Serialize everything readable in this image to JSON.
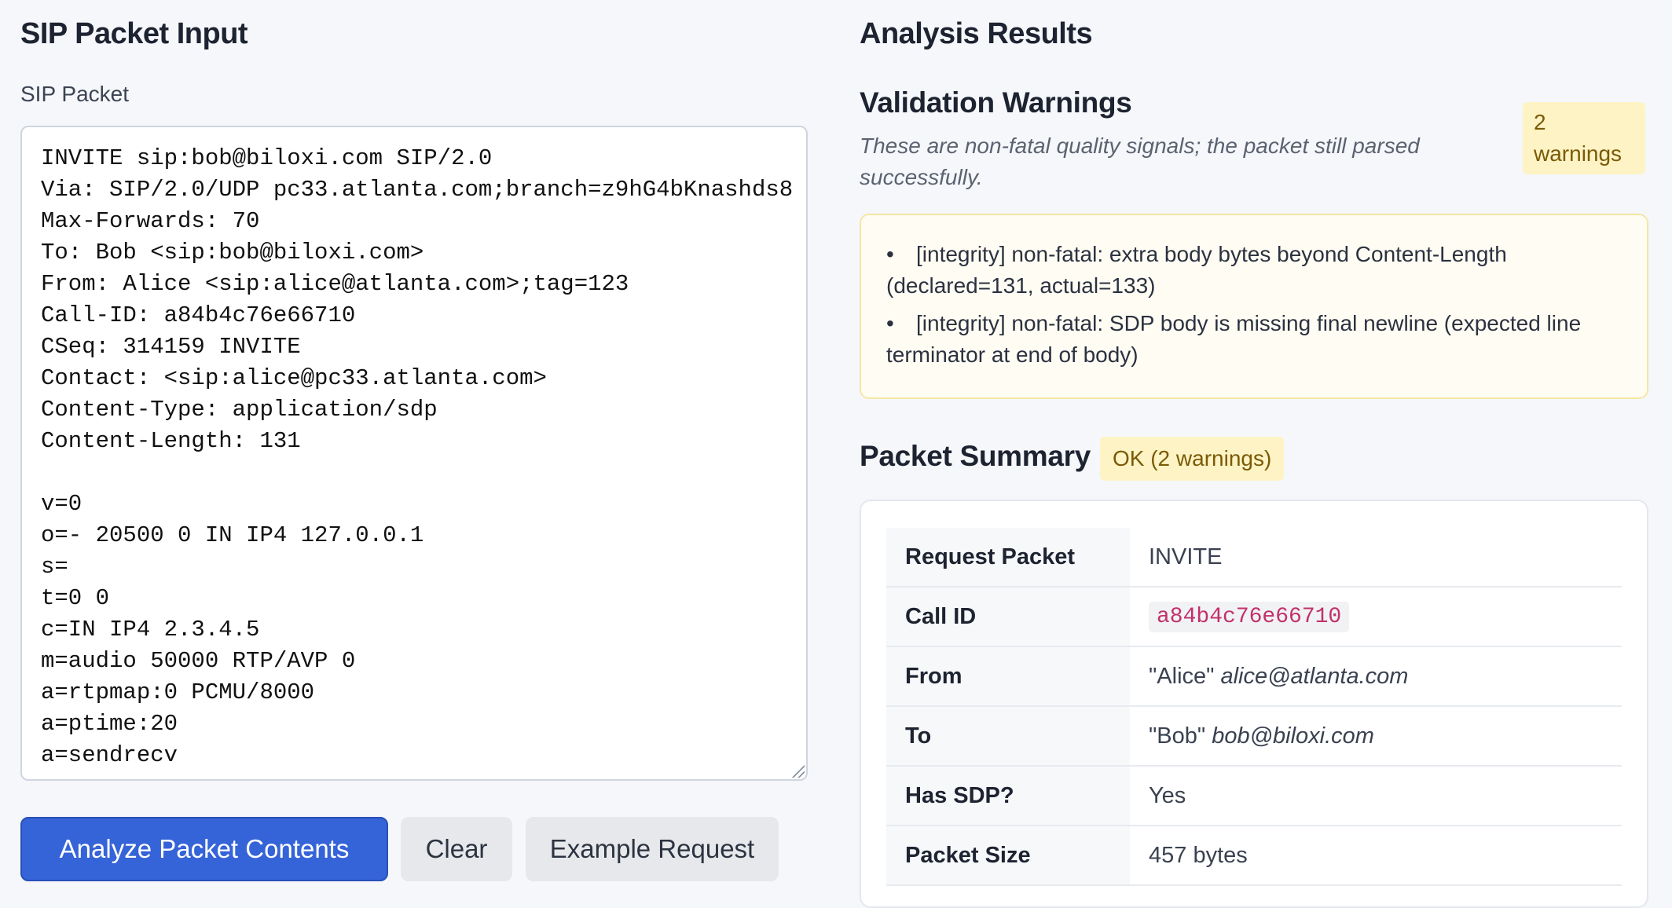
{
  "input": {
    "title": "SIP Packet Input",
    "field_label": "SIP Packet",
    "packet_lines": [
      "INVITE sip:bob@biloxi.com SIP/2.0",
      "Via: SIP/2.0/UDP pc33.atlanta.com;branch=z9hG4bKnashds8",
      "Max-Forwards: 70",
      "To: Bob <sip:bob@biloxi.com>",
      "From: Alice <sip:alice@atlanta.com>;tag=123",
      "Call-ID: a84b4c76e66710",
      "CSeq: 314159 INVITE",
      "Contact: <sip:alice@pc33.atlanta.com>",
      "Content-Type: application/sdp",
      "Content-Length: 131",
      "",
      "v=0",
      "o=- 20500 0 IN IP4 127.0.0.1",
      "s=",
      "t=0 0",
      "c=IN IP4 2.3.4.5",
      "m=audio 50000 RTP/AVP 0",
      "a=rtpmap:0 PCMU/8000",
      "a=ptime:20",
      "a=sendrecv"
    ],
    "buttons": {
      "analyze": "Analyze Packet Contents",
      "clear": "Clear",
      "example": "Example Request"
    }
  },
  "results": {
    "title": "Analysis Results",
    "warnings": {
      "title": "Validation Warnings",
      "description": "These are non-fatal quality signals; the packet still parsed successfully.",
      "count_label": "2 warnings",
      "items": [
        "[integrity] non-fatal: extra body bytes beyond Content-Length (declared=131, actual=133)",
        "[integrity] non-fatal: SDP body is missing final newline (expected line terminator at end of body)"
      ]
    },
    "summary": {
      "title": "Packet Summary",
      "status": "OK (2 warnings)",
      "rows": [
        {
          "key": "Request Packet",
          "value": "INVITE"
        },
        {
          "key": "Call ID",
          "value": "a84b4c76e66710"
        },
        {
          "key": "From",
          "value_name": "\"Alice\"",
          "value_addr": "alice@atlanta.com"
        },
        {
          "key": "To",
          "value_name": "\"Bob\"",
          "value_addr": "bob@biloxi.com"
        },
        {
          "key": "Has SDP?",
          "value": "Yes"
        },
        {
          "key": "Packet Size",
          "value": "457 bytes"
        }
      ]
    }
  },
  "colors": {
    "primary": "#3563d8",
    "warning_bg": "#fdf3c4",
    "warning_text": "#7a5a07",
    "code": "#c2306b"
  }
}
